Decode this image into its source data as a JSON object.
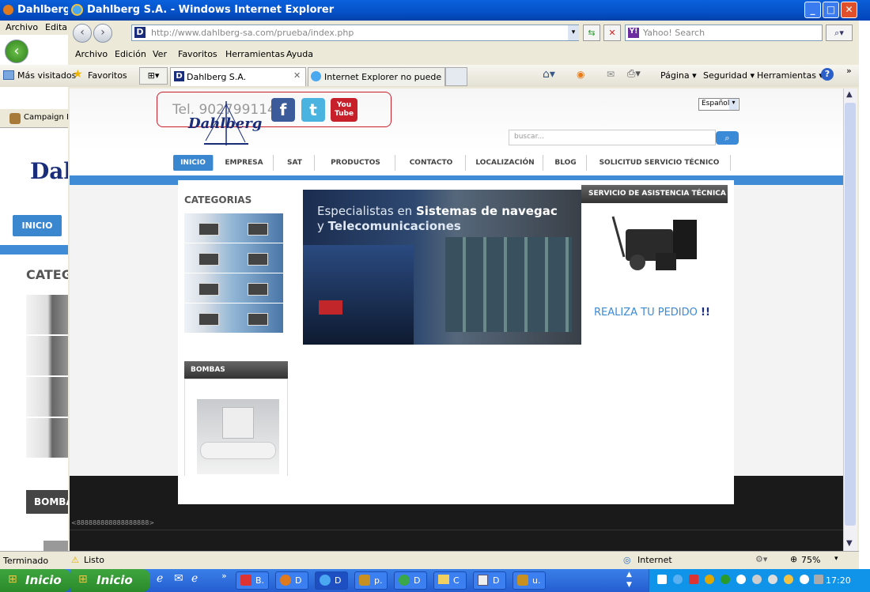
{
  "bg_window": {
    "title": "Dahlberg S.",
    "menu": [
      "Archivo",
      "Editar"
    ],
    "campaign_tab": "Campaign B",
    "inicio": "INICIO",
    "categorias": "CATEG",
    "bombas": "BOMBA",
    "status": "Terminado"
  },
  "window": {
    "title": "Dahlberg S.A. - Windows Internet Explorer",
    "min": "_",
    "max": "□",
    "close": "✕"
  },
  "address": {
    "url": "http://www.dahlberg-sa.com/prueba/index.php",
    "search_placeholder": "Yahoo! Search"
  },
  "menu": [
    "Archivo",
    "Edición",
    "Ver",
    "Favoritos",
    "Herramientas",
    "Ayuda"
  ],
  "favbar": {
    "mas_visitados": "Más visitados",
    "favoritos": "Favoritos"
  },
  "tabs": [
    {
      "label": "Dahlberg S.A."
    },
    {
      "label": "Internet Explorer no puede ..."
    }
  ],
  "commands": [
    "Página ▾",
    "Seguridad ▾",
    "Herramientas ▾"
  ],
  "page": {
    "tel": "Tel. 902799114",
    "logo": "Dahlberg",
    "youtube": "You Tube",
    "language": "Español",
    "search_placeholder": "buscar...",
    "nav": [
      "INICIO",
      "EMPRESA",
      "SAT",
      "PRODUCTOS",
      "CONTACTO",
      "LOCALIZACIÓN",
      "BLOG",
      "SOLICITUD SERVICIO TÉCNICO"
    ],
    "categorias": "CATEGORIAS",
    "banner_line1_pre": "Especialistas en ",
    "banner_line1_bold": "Sistemas de navegac",
    "banner_line2_pre": "y ",
    "banner_line2_bold": "Telecomunicaciones",
    "sat_title": "SERVICIO DE ASISTENCIA TÉCNICA",
    "realiza": "REALIZA TU PEDIDO",
    "realiza_mark": "!!",
    "bombas": "BOMBAS",
    "footer_code": "<888888888888888888>"
  },
  "status": {
    "text": "Listo",
    "zone": "Internet",
    "zoom": "75%"
  },
  "taskbar": {
    "start": "Inicio",
    "start2": "Inicio",
    "tasks": [
      "B.",
      "D",
      "D",
      "p.",
      "D",
      "C",
      "D",
      "u."
    ],
    "clock": "17:20"
  },
  "colors": {
    "accent": "#3a87d0",
    "xp_blue": "#0551c8",
    "start_green": "#2a8a2a"
  }
}
